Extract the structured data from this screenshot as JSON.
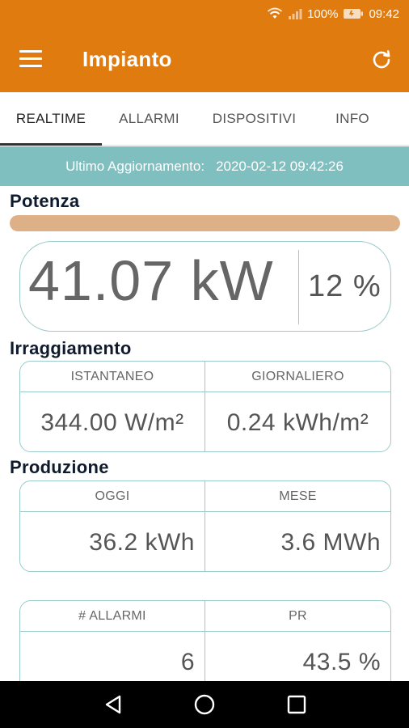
{
  "status_bar": {
    "battery": "100%",
    "time": "09:42"
  },
  "app_bar": {
    "title": "Impianto"
  },
  "tabs": [
    {
      "label": "REALTIME",
      "active": true
    },
    {
      "label": "ALLARMI",
      "active": false
    },
    {
      "label": "DISPOSITIVI",
      "active": false
    },
    {
      "label": "INFO",
      "active": false
    }
  ],
  "update_banner": {
    "label": "Ultimo Aggiornamento:",
    "value": "2020-02-12 09:42:26"
  },
  "potenza": {
    "title": "Potenza",
    "value": "41.07 kW",
    "percent": "12 %",
    "bar_fill_fraction": 1.0
  },
  "irraggiamento": {
    "title": "Irraggiamento",
    "headers": [
      "ISTANTANEO",
      "GIORNALIERO"
    ],
    "values": [
      "344.00 W/m²",
      "0.24 kWh/m²"
    ]
  },
  "produzione": {
    "title": "Produzione",
    "headers": [
      "OGGI",
      "MESE"
    ],
    "values": [
      "36.2 kWh",
      "3.6 MWh"
    ]
  },
  "stats": {
    "headers": [
      "# ALLARMI",
      "PR"
    ],
    "values": [
      "6",
      "43.5 %"
    ]
  },
  "colors": {
    "accent": "#e07b10",
    "banner": "#7fbfbf",
    "border": "#9ccaca",
    "bar": "#ddb088"
  },
  "icons": {
    "menu": "hamburger-icon",
    "refresh": "refresh-icon",
    "wifi": "wifi-icon",
    "signal": "signal-icon",
    "battery": "battery-icon",
    "nav_back": "back-triangle-icon",
    "nav_home": "home-circle-icon",
    "nav_recents": "recents-square-icon"
  }
}
